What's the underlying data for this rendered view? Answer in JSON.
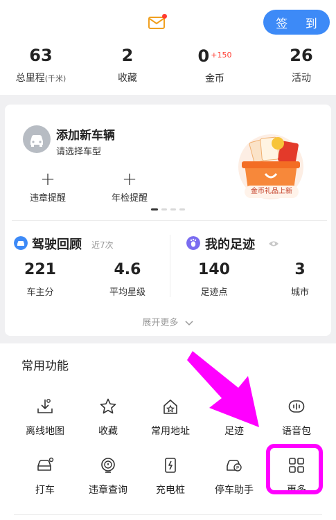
{
  "header": {
    "mail_icon": "envelope-icon",
    "signin_label": "签 到",
    "accent": "#3d8af7"
  },
  "stats": [
    {
      "value": "63",
      "label": "总里程",
      "unit": "(千米)"
    },
    {
      "value": "2",
      "label": "收藏"
    },
    {
      "value": "0",
      "plus": "+150",
      "label": "金币"
    },
    {
      "value": "26",
      "label": "活动"
    }
  ],
  "vehicle": {
    "title": "添加新车辆",
    "subtitle": "请选择车型",
    "reminders": [
      "违章提醒",
      "年检提醒"
    ],
    "promo_label": "金币礼品上新"
  },
  "driving": {
    "title": "驾驶回顾",
    "note": "近7次",
    "metrics": [
      {
        "value": "221",
        "label": "车主分"
      },
      {
        "value": "4.6",
        "label": "平均星级"
      }
    ]
  },
  "footprint": {
    "title": "我的足迹",
    "metrics": [
      {
        "value": "140",
        "label": "足迹点"
      },
      {
        "value": "3",
        "label": "城市"
      }
    ]
  },
  "expand_label": "展开更多",
  "functions": {
    "title": "常用功能",
    "items": [
      {
        "label": "离线地图",
        "icon": "offline-map-icon"
      },
      {
        "label": "收藏",
        "icon": "star-icon"
      },
      {
        "label": "常用地址",
        "icon": "home-star-icon"
      },
      {
        "label": "足迹",
        "icon": "footprint-icon"
      },
      {
        "label": "语音包",
        "icon": "voice-pack-icon"
      },
      {
        "label": "打车",
        "icon": "taxi-icon"
      },
      {
        "label": "违章查询",
        "icon": "violation-query-icon"
      },
      {
        "label": "充电桩",
        "icon": "charging-pile-icon"
      },
      {
        "label": "停车助手",
        "icon": "parking-assistant-icon"
      },
      {
        "label": "更多",
        "icon": "more-grid-icon"
      }
    ]
  },
  "highlight_color": "#ff00ff"
}
